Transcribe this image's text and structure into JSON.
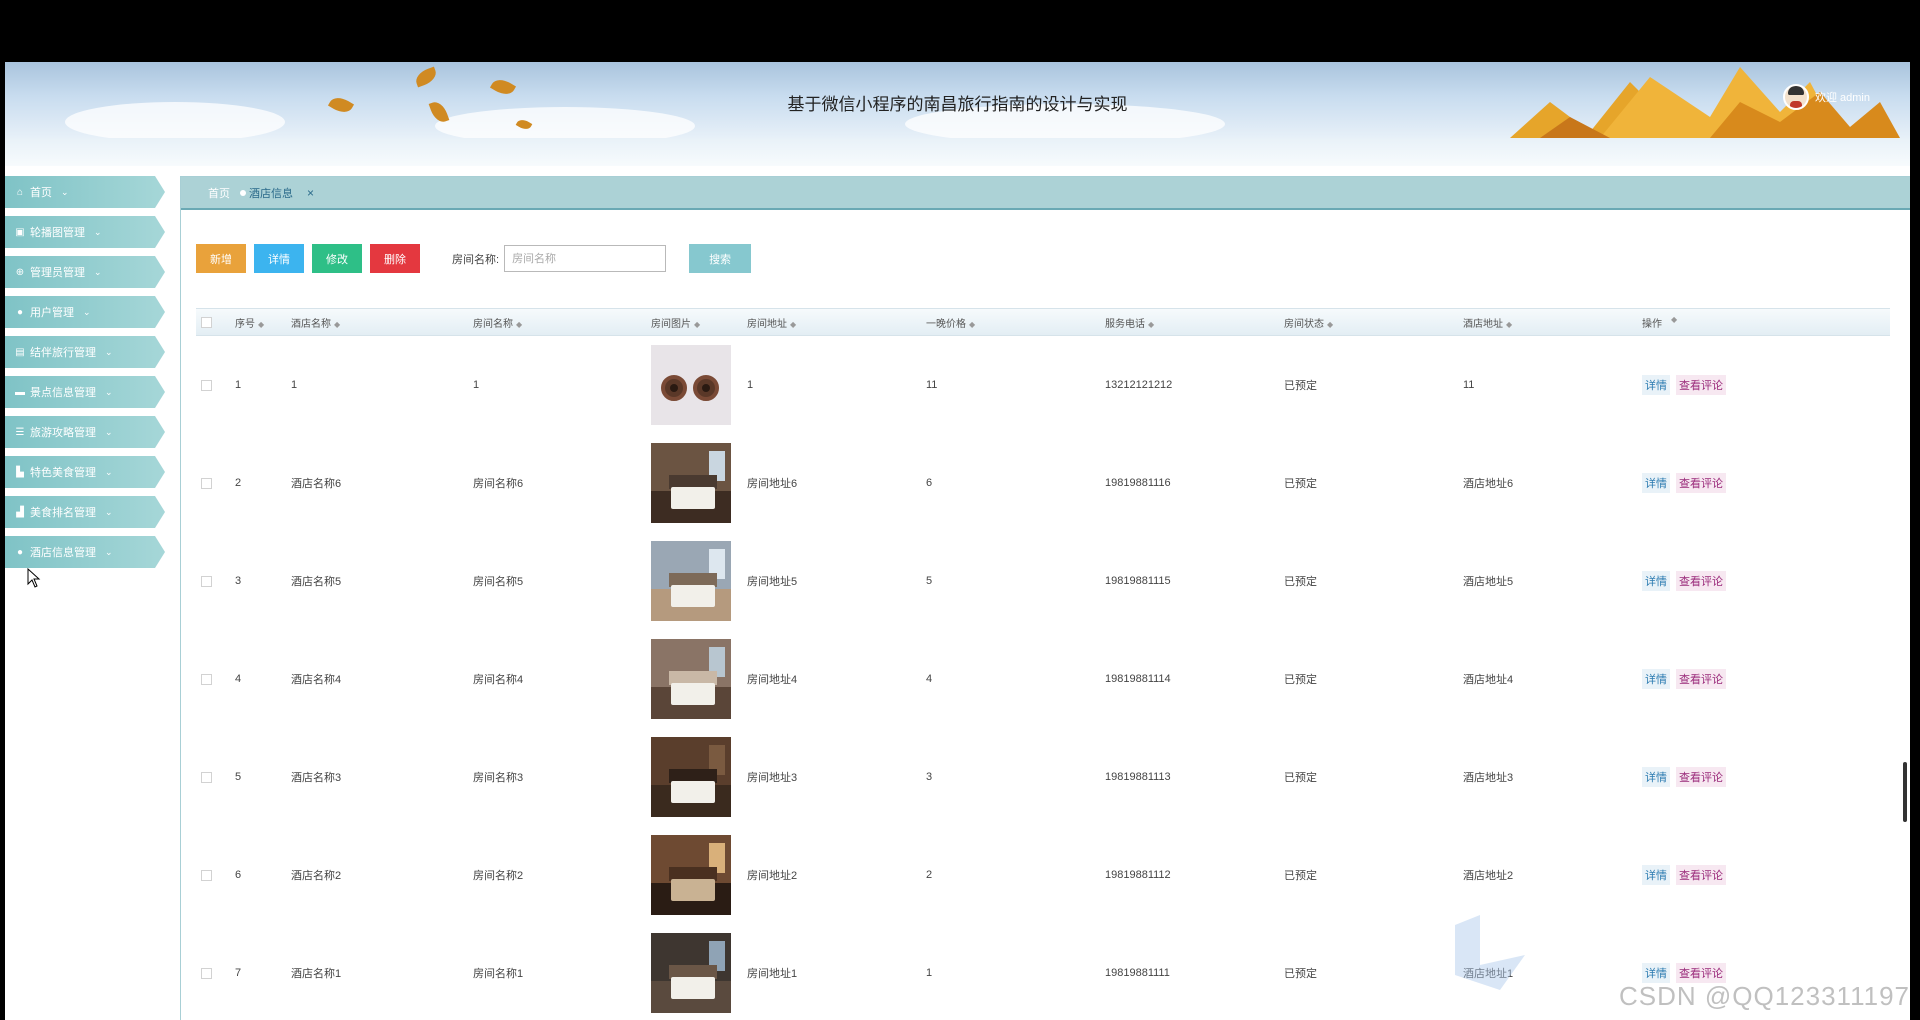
{
  "header": {
    "title": "基于微信小程序的南昌旅行指南的设计与实现",
    "welcome": "欢迎 admin"
  },
  "sidebar": {
    "items": [
      {
        "label": "首页",
        "icon": "home-icon"
      },
      {
        "label": "轮播图管理",
        "icon": "image-icon"
      },
      {
        "label": "管理员管理",
        "icon": "plus-circle-icon"
      },
      {
        "label": "用户管理",
        "icon": "user-icon"
      },
      {
        "label": "结伴旅行管理",
        "icon": "picture-icon"
      },
      {
        "label": "景点信息管理",
        "icon": "briefcase-icon"
      },
      {
        "label": "旅游攻略管理",
        "icon": "list-icon"
      },
      {
        "label": "特色美食管理",
        "icon": "food-icon"
      },
      {
        "label": "美食排名管理",
        "icon": "ranking-icon"
      },
      {
        "label": "酒店信息管理",
        "icon": "drop-icon"
      }
    ]
  },
  "tabs": {
    "home": "首页",
    "active": "酒店信息",
    "close": "×"
  },
  "toolbar": {
    "add": "新增",
    "detail": "详情",
    "edit": "修改",
    "delete": "删除",
    "search_label": "房间名称:",
    "search_placeholder": "房间名称",
    "search_button": "搜索"
  },
  "table": {
    "columns": [
      "序号",
      "酒店名称",
      "房间名称",
      "房间图片",
      "房间地址",
      "一晚价格",
      "服务电话",
      "房间状态",
      "酒店地址",
      "操作"
    ],
    "action_detail": "详情",
    "action_review": "查看评论",
    "rows": [
      {
        "no": "1",
        "hotel": "1",
        "room": "1",
        "image": "bottle-caps",
        "address": "1",
        "price": "11",
        "phone": "13212121212",
        "status": "已预定",
        "hotel_address": "11"
      },
      {
        "no": "2",
        "hotel": "酒店名称6",
        "room": "房间名称6",
        "image": "hotel-room",
        "address": "房间地址6",
        "price": "6",
        "phone": "19819881116",
        "status": "已预定",
        "hotel_address": "酒店地址6"
      },
      {
        "no": "3",
        "hotel": "酒店名称5",
        "room": "房间名称5",
        "image": "hotel-room",
        "address": "房间地址5",
        "price": "5",
        "phone": "19819881115",
        "status": "已预定",
        "hotel_address": "酒店地址5"
      },
      {
        "no": "4",
        "hotel": "酒店名称4",
        "room": "房间名称4",
        "image": "hotel-room",
        "address": "房间地址4",
        "price": "4",
        "phone": "19819881114",
        "status": "已预定",
        "hotel_address": "酒店地址4"
      },
      {
        "no": "5",
        "hotel": "酒店名称3",
        "room": "房间名称3",
        "image": "hotel-room",
        "address": "房间地址3",
        "price": "3",
        "phone": "19819881113",
        "status": "已预定",
        "hotel_address": "酒店地址3"
      },
      {
        "no": "6",
        "hotel": "酒店名称2",
        "room": "房间名称2",
        "image": "hotel-room",
        "address": "房间地址2",
        "price": "2",
        "phone": "19819881112",
        "status": "已预定",
        "hotel_address": "酒店地址2"
      },
      {
        "no": "7",
        "hotel": "酒店名称1",
        "room": "房间名称1",
        "image": "hotel-room",
        "address": "房间地址1",
        "price": "1",
        "phone": "19819881111",
        "status": "已预定",
        "hotel_address": "酒店地址1"
      }
    ]
  },
  "watermark": "CSDN @QQ123311197",
  "colors": {
    "sidebar": "#7fc3c6",
    "tabbar": "#acd2d6",
    "add": "#e9a23b",
    "detail": "#3cb4ef",
    "edit": "#2ebf87",
    "delete": "#e4383f",
    "search": "#86c8cf"
  }
}
